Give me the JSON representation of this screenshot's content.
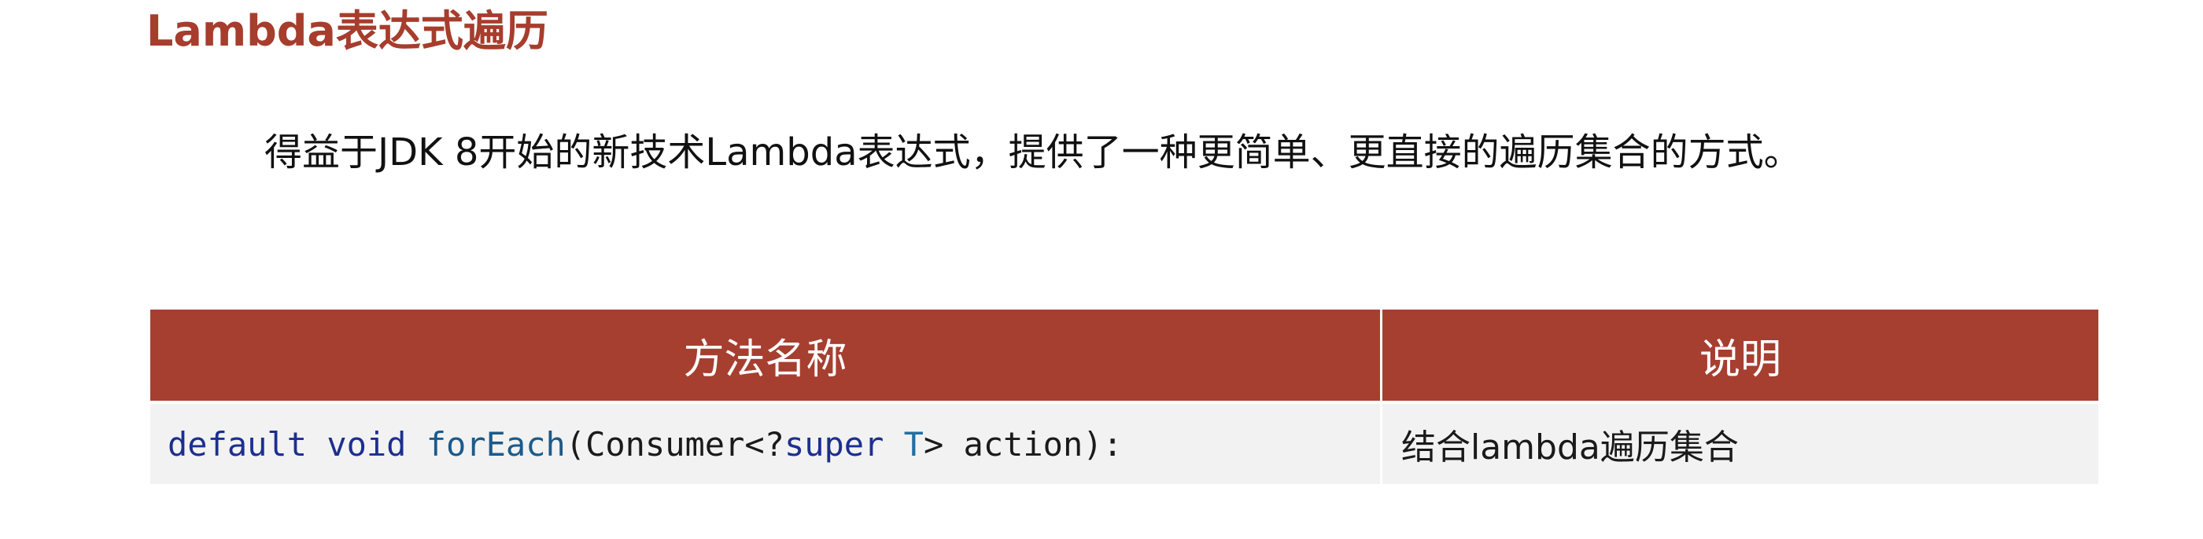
{
  "title": "Lambda表达式遍历",
  "intro": "得益于JDK 8开始的新技术Lambda表达式，提供了一种更简单、更直接的遍历集合的方式。",
  "table": {
    "headers": [
      "方法名称",
      "说明"
    ],
    "rows": [
      {
        "method": {
          "kw_default": "default",
          "kw_void": "void",
          "fn_name": "forEach",
          "open": "(Consumer<? ",
          "kw_super": "super",
          "type_T": "T",
          "close": "> action):"
        },
        "description": "结合lambda遍历集合"
      }
    ]
  },
  "colors": {
    "accent": "#a63f30",
    "title": "#a63d2d",
    "row_bg": "#f2f2f2",
    "keyword": "#1c2f8f"
  }
}
